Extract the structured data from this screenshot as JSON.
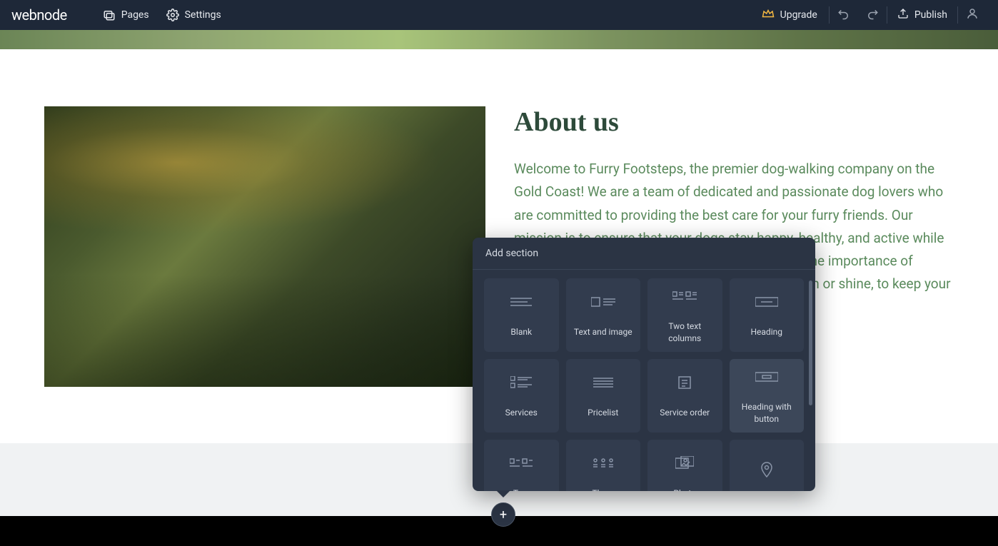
{
  "brand": "webnode",
  "topnav": {
    "pages": "Pages",
    "settings": "Settings",
    "upgrade": "Upgrade",
    "publish": "Publish"
  },
  "about": {
    "heading": "About us",
    "body": "Welcome to Furry Footsteps, the premier dog-walking company on the Gold Coast! We are a team of dedicated and passionate dog lovers who are committed to providing the best care for your furry friends. Our mission is to ensure that your dogs stay happy, healthy, and active while you are busy. At Furry Footsteps, we understand the importance of regular exercise for dogs. We offer daily walks, rain or shine, to keep your pets fit, healthy, and engaged."
  },
  "popover": {
    "title": "Add section",
    "tiles": [
      {
        "label": "Blank",
        "icon": "blank"
      },
      {
        "label": "Text and image",
        "icon": "text-image"
      },
      {
        "label": "Two text columns",
        "icon": "two-columns"
      },
      {
        "label": "Heading",
        "icon": "heading"
      },
      {
        "label": "Services",
        "icon": "services"
      },
      {
        "label": "Pricelist",
        "icon": "pricelist"
      },
      {
        "label": "Service order",
        "icon": "service-order"
      },
      {
        "label": "Heading with button",
        "icon": "heading-button",
        "hover": true
      },
      {
        "label": "Two",
        "icon": "two"
      },
      {
        "label": "Three",
        "icon": "three"
      },
      {
        "label": "Photo",
        "icon": "photo"
      },
      {
        "label": "",
        "icon": "map"
      }
    ]
  },
  "colors": {
    "upgrade_accent": "#f5b942",
    "heading_color": "#2d4a3a",
    "body_color": "#5a8a5c"
  }
}
